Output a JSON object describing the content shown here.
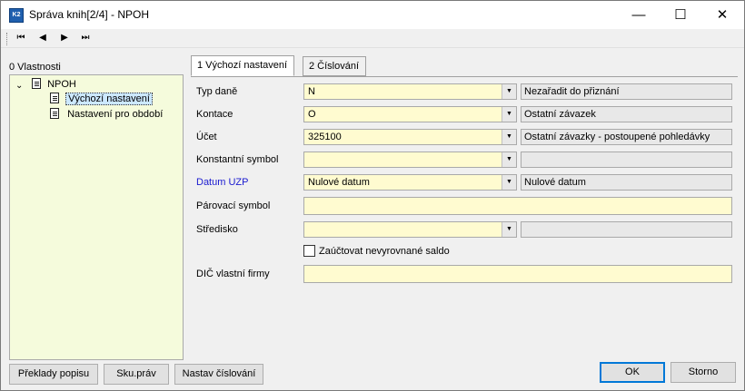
{
  "window": {
    "app_icon": "K2",
    "title": "Správa knih[2/4] - NPOH",
    "minimize": "—",
    "maximize": "☐",
    "close": "✕"
  },
  "toolbar": {
    "first": "⏮",
    "prev": "◀",
    "next": "▶",
    "last": "⏭"
  },
  "properties": {
    "label": "0 Vlastnosti",
    "tree": {
      "root": {
        "label": "NPOH",
        "toggle": "⌄"
      },
      "children": [
        {
          "label": "Výchozí nastavení",
          "selected": true
        },
        {
          "label": "Nastavení pro období",
          "selected": false
        }
      ]
    }
  },
  "tabs": [
    {
      "label": "1 Výchozí nastavení",
      "active": true
    },
    {
      "label": "2 Číslování",
      "active": false
    }
  ],
  "fields": {
    "typ_dane": {
      "label": "Typ daně",
      "value": "N",
      "desc": "Nezařadit do přiznání"
    },
    "kontace": {
      "label": "Kontace",
      "value": "O",
      "desc": "Ostatní závazek"
    },
    "ucet": {
      "label": "Účet",
      "value": "325100",
      "desc": "Ostatní závazky - postoupené pohledávky"
    },
    "konstantni_symbol": {
      "label": "Konstantní symbol",
      "value": "",
      "desc": ""
    },
    "datum_uzp": {
      "label": "Datum UZP",
      "value": "Nulové datum",
      "desc": "Nulové datum"
    },
    "parovaci_symbol": {
      "label": "Párovací symbol",
      "value": ""
    },
    "stredisko": {
      "label": "Středisko",
      "value": "",
      "desc": ""
    },
    "zauctovat": {
      "label": "Zaúčtovat nevyrovnané saldo",
      "checked": false
    },
    "dic": {
      "label": "DIČ vlastní firmy",
      "value": ""
    }
  },
  "buttons": {
    "preklady": "Překlady popisu",
    "sku_prav": "Sku.práv",
    "nastav_cislovani": "Nastav číslování",
    "ok": "OK",
    "storno": "Storno"
  },
  "colors": {
    "input_bg": "#fffbd0",
    "tree_bg": "#f5fbdc",
    "selection": "#cce8ff",
    "blue_label": "#1a1ad0",
    "default_button_border": "#0078d7"
  }
}
